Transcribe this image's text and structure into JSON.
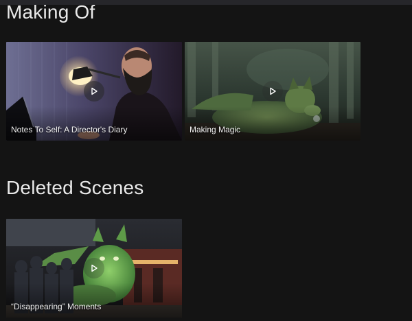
{
  "sections": [
    {
      "title": "Making Of",
      "cards": [
        {
          "label": "Notes To Self: A Director's Diary"
        },
        {
          "label": "Making Magic"
        }
      ]
    },
    {
      "title": "Deleted Scenes",
      "cards": [
        {
          "label": "“Disappearing” Moments"
        }
      ]
    }
  ],
  "icons": {
    "play": "play-icon"
  },
  "colors": {
    "background": "#141414",
    "text": "#e9e9e9"
  }
}
